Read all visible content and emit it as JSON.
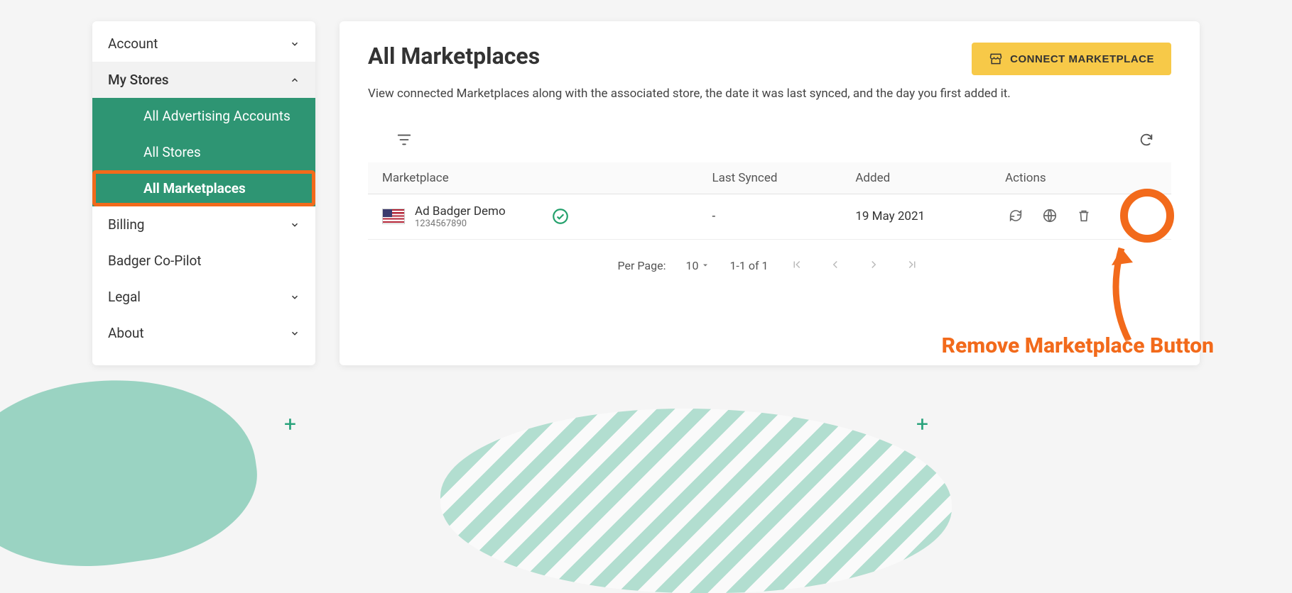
{
  "sidebar": {
    "account": "Account",
    "my_stores": "My Stores",
    "sub_all_adv": "All Advertising Accounts",
    "sub_all_stores": "All Stores",
    "sub_all_mk": "All Marketplaces",
    "billing": "Billing",
    "copilot": "Badger Co-Pilot",
    "legal": "Legal",
    "about": "About"
  },
  "main": {
    "title": "All Marketplaces",
    "connect_btn": "CONNECT MARKETPLACE",
    "subtitle": "View connected Marketplaces along with the associated store, the date it was last synced, and the day you first added it.",
    "cols": {
      "marketplace": "Marketplace",
      "last_synced": "Last Synced",
      "added": "Added",
      "actions": "Actions"
    },
    "row": {
      "name": "Ad Badger Demo",
      "id": "1234567890",
      "last_synced": "-",
      "added": "19 May 2021"
    },
    "pager": {
      "per_page_label": "Per Page:",
      "per_page_value": "10",
      "range": "1-1 of 1"
    }
  },
  "annotation": {
    "label": "Remove Marketplace Button"
  }
}
